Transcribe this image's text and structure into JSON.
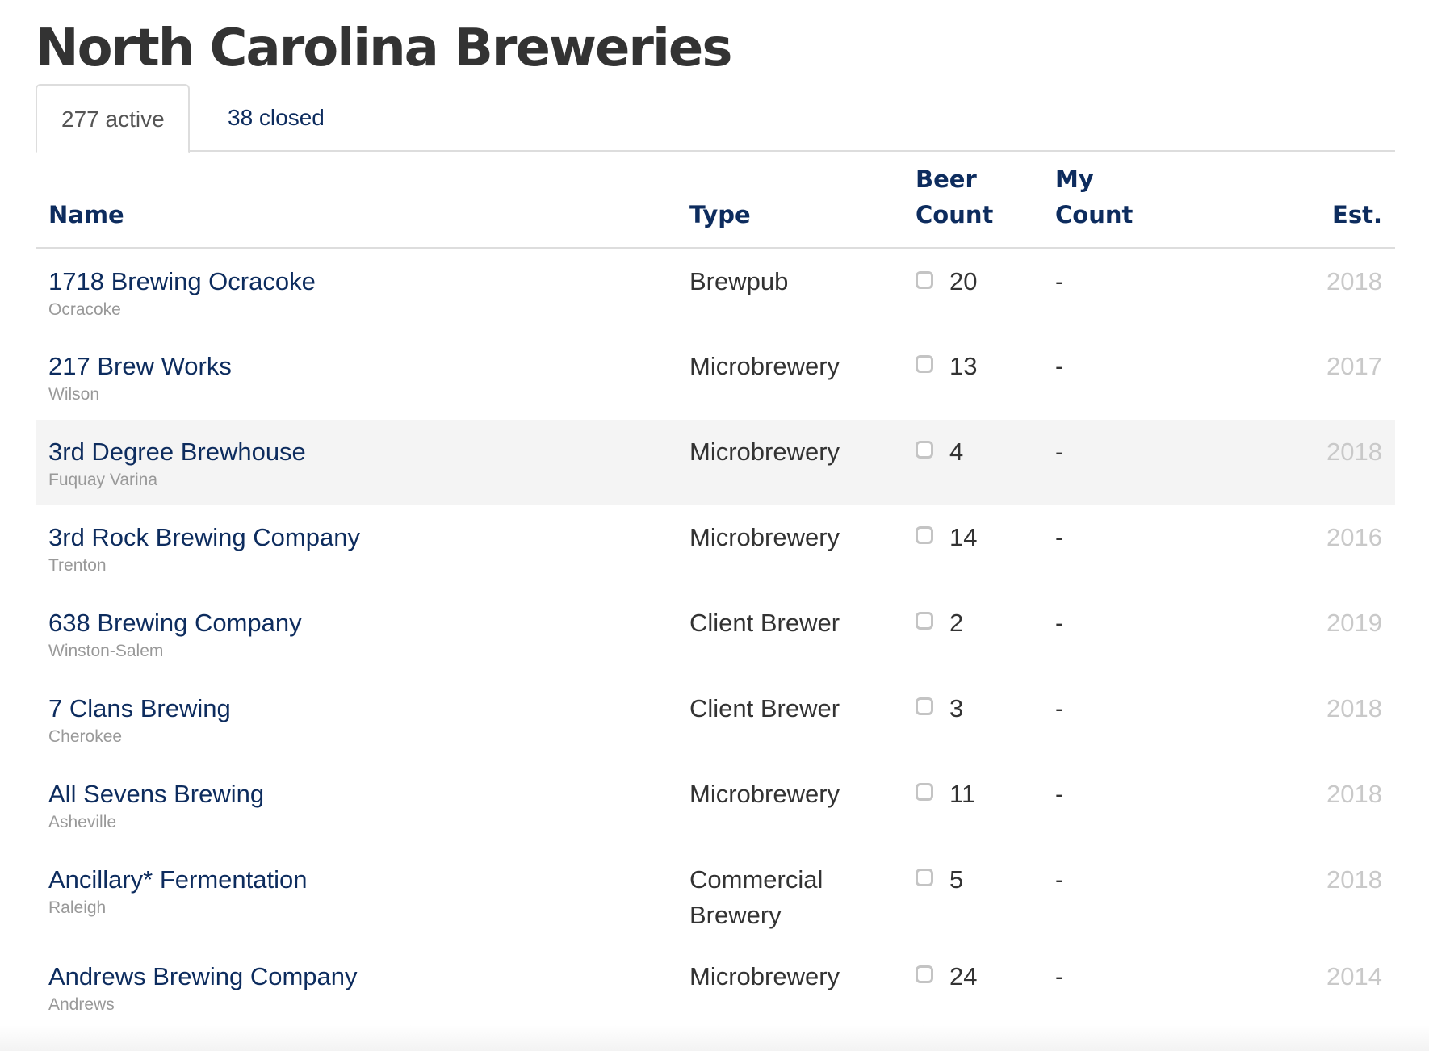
{
  "page": {
    "title": "North Carolina Breweries"
  },
  "tabs": [
    {
      "label": "277 active",
      "active": true
    },
    {
      "label": "38 closed",
      "active": false
    }
  ],
  "table": {
    "headers": {
      "name": "Name",
      "type": "Type",
      "beer_count_line1": "Beer",
      "beer_count_line2": "Count",
      "my_count_line1": "My",
      "my_count_line2": "Count",
      "est": "Est."
    },
    "rows": [
      {
        "name": "1718 Brewing Ocracoke",
        "city": "Ocracoke",
        "type": "Brewpub",
        "beer_count": "20",
        "my_count": "-",
        "est": "2018"
      },
      {
        "name": "217 Brew Works",
        "city": "Wilson",
        "type": "Microbrewery",
        "beer_count": "13",
        "my_count": "-",
        "est": "2017"
      },
      {
        "name": "3rd Degree Brewhouse",
        "city": "Fuquay Varina",
        "type": "Microbrewery",
        "beer_count": "4",
        "my_count": "-",
        "est": "2018"
      },
      {
        "name": "3rd Rock Brewing Company",
        "city": "Trenton",
        "type": "Microbrewery",
        "beer_count": "14",
        "my_count": "-",
        "est": "2016"
      },
      {
        "name": "638 Brewing Company",
        "city": "Winston-Salem",
        "type": "Client Brewer",
        "beer_count": "2",
        "my_count": "-",
        "est": "2019"
      },
      {
        "name": "7 Clans Brewing",
        "city": "Cherokee",
        "type": "Client Brewer",
        "beer_count": "3",
        "my_count": "-",
        "est": "2018"
      },
      {
        "name": "All Sevens Brewing",
        "city": "Asheville",
        "type": "Microbrewery",
        "beer_count": "11",
        "my_count": "-",
        "est": "2018"
      },
      {
        "name": "Ancillary* Fermentation",
        "city": "Raleigh",
        "type": "Commercial Brewery",
        "beer_count": "5",
        "my_count": "-",
        "est": "2018"
      },
      {
        "name": "Andrews Brewing Company",
        "city": "Andrews",
        "type": "Microbrewery",
        "beer_count": "24",
        "my_count": "-",
        "est": "2014"
      }
    ]
  },
  "colors": {
    "link": "#0d2c5e",
    "text": "#333333",
    "muted": "#999999",
    "year": "#c9c9c9",
    "row_highlight": "#f4f4f4",
    "border": "#dddddd"
  }
}
